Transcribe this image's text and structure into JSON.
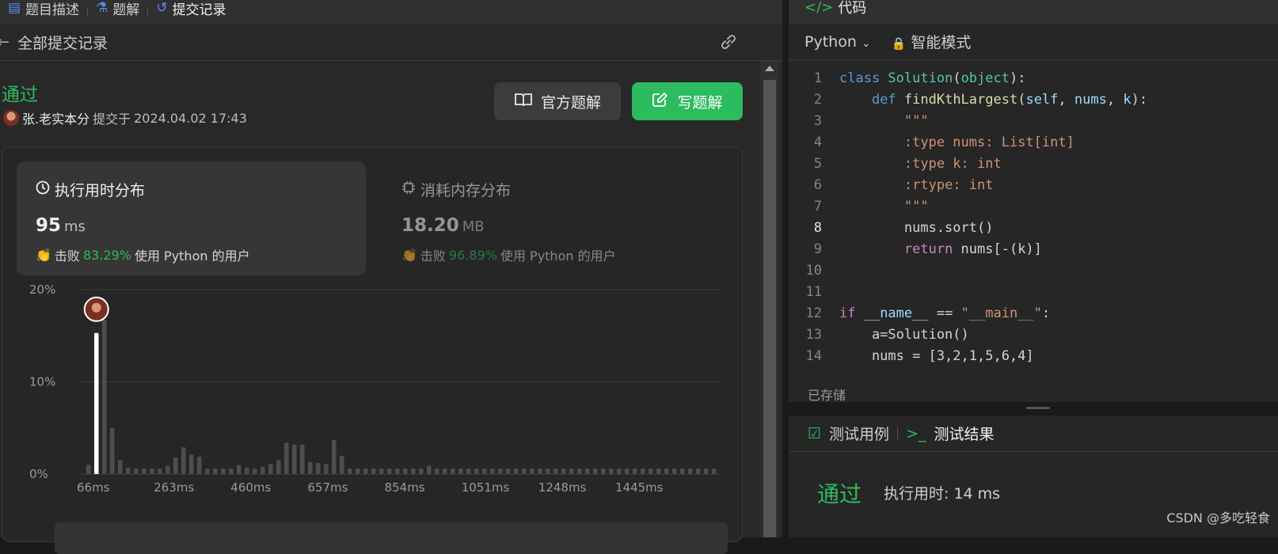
{
  "topbar": {
    "tabs": [
      {
        "label": "题目描述",
        "icon": "doc-icon"
      },
      {
        "label": "题解",
        "icon": "flask-icon"
      },
      {
        "label": "提交记录",
        "icon": "history-icon"
      }
    ]
  },
  "subbar": {
    "back_icon": "arrow-left-icon",
    "title": "全部提交记录",
    "share_icon": "link-icon"
  },
  "submission": {
    "status": "通过",
    "user": "张.老实本分",
    "submitted_prefix": "提交于",
    "submitted_at": "2024.04.02 17:43"
  },
  "buttons": {
    "official": "官方题解",
    "write": "写题解"
  },
  "runtime": {
    "title": "执行用时分布",
    "value": "95",
    "unit": "ms",
    "beat_label": "击败",
    "beat_pct": "83.29%",
    "beat_suffix": "使用 Python 的用户"
  },
  "memory": {
    "title": "消耗内存分布",
    "value": "18.20",
    "unit": "MB",
    "beat_label": "击败",
    "beat_pct": "96.89%",
    "beat_suffix": "使用 Python 的用户"
  },
  "chart_data": {
    "type": "bar",
    "y_tick_labels": [
      "20%",
      "10%",
      "0%"
    ],
    "x_tick_labels": [
      "66ms",
      "263ms",
      "460ms",
      "657ms",
      "854ms",
      "1051ms",
      "1248ms",
      "1445ms"
    ],
    "ylim": [
      0,
      20
    ],
    "values": [
      1.0,
      15.3,
      16.7,
      5.0,
      1.5,
      0.7,
      0.6,
      0.6,
      0.6,
      0.6,
      0.9,
      1.8,
      2.9,
      2.1,
      1.9,
      0.6,
      0.6,
      0.6,
      0.6,
      1.0,
      0.7,
      0.6,
      0.8,
      1.1,
      1.5,
      3.4,
      3.2,
      3.2,
      1.3,
      1.2,
      1.1,
      3.7,
      2.0,
      0.6,
      0.6,
      0.6,
      0.6,
      0.6,
      0.6,
      0.6,
      0.6,
      0.6,
      0.6,
      0.9,
      0.6,
      0.6,
      0.6,
      0.6,
      0.6,
      0.6,
      0.6,
      0.6,
      0.6,
      0.6,
      0.6,
      0.6,
      0.6,
      0.6,
      0.6,
      0.6,
      0.6,
      0.6,
      0.6,
      0.6,
      0.6,
      0.6,
      0.6,
      0.6,
      0.6,
      0.6,
      0.6,
      0.6,
      0.6,
      0.6,
      0.6,
      0.6,
      0.6,
      0.6,
      0.6,
      0.6
    ],
    "highlight_index": 1,
    "colors": {
      "bar": "#4d4d4d",
      "highlight": "#ffffff",
      "grid": "#3c3c3c"
    }
  },
  "editor": {
    "title": "代码",
    "language": "Python",
    "mode": "智能模式",
    "saved": "已存储",
    "current_line": 8,
    "lines": [
      {
        "n": "1"
      },
      {
        "n": "2"
      },
      {
        "n": "3"
      },
      {
        "n": "4"
      },
      {
        "n": "5"
      },
      {
        "n": "6"
      },
      {
        "n": "7"
      },
      {
        "n": "8"
      },
      {
        "n": "9"
      },
      {
        "n": "10"
      },
      {
        "n": "11"
      },
      {
        "n": "12"
      },
      {
        "n": "13"
      },
      {
        "n": "14"
      }
    ],
    "code": [
      [
        [
          "kw",
          "class "
        ],
        [
          "cls",
          "Solution"
        ],
        [
          "src",
          "("
        ],
        [
          "cls",
          "object"
        ],
        [
          "src",
          "):"
        ]
      ],
      [
        [
          "src",
          "    "
        ],
        [
          "kw",
          "def "
        ],
        [
          "fn",
          "findKthLargest"
        ],
        [
          "src",
          "("
        ],
        [
          "pm",
          "self"
        ],
        [
          "src",
          ", "
        ],
        [
          "pm",
          "nums"
        ],
        [
          "src",
          ", "
        ],
        [
          "pm",
          "k"
        ],
        [
          "src",
          "):"
        ]
      ],
      [
        [
          "src",
          "        "
        ],
        [
          "st",
          "\"\"\""
        ]
      ],
      [
        [
          "src",
          "        "
        ],
        [
          "st",
          ":type nums: List[int]"
        ]
      ],
      [
        [
          "src",
          "        "
        ],
        [
          "st",
          ":type k: int"
        ]
      ],
      [
        [
          "src",
          "        "
        ],
        [
          "st",
          ":rtype: int"
        ]
      ],
      [
        [
          "src",
          "        "
        ],
        [
          "st",
          "\"\"\""
        ]
      ],
      [
        [
          "src",
          "        nums.sort()"
        ]
      ],
      [
        [
          "src",
          "        "
        ],
        [
          "kw2",
          "return "
        ],
        [
          "src",
          "nums[-(k)]"
        ]
      ],
      [
        [
          "src",
          ""
        ]
      ],
      [
        [
          "src",
          ""
        ]
      ],
      [
        [
          "kw2",
          "if "
        ],
        [
          "pm",
          "__name__"
        ],
        [
          "src",
          " == "
        ],
        [
          "st",
          "\"__main__\""
        ],
        [
          "src",
          ":"
        ]
      ],
      [
        [
          "src",
          "    a=Solution()"
        ]
      ],
      [
        [
          "src",
          "    nums = [3,2,1,5,6,4]"
        ]
      ]
    ]
  },
  "results": {
    "tab_cases": "测试用例",
    "tab_result": "测试结果",
    "status": "通过",
    "runtime": "执行用时: 14 ms"
  },
  "watermark": "CSDN @多吃轻食"
}
